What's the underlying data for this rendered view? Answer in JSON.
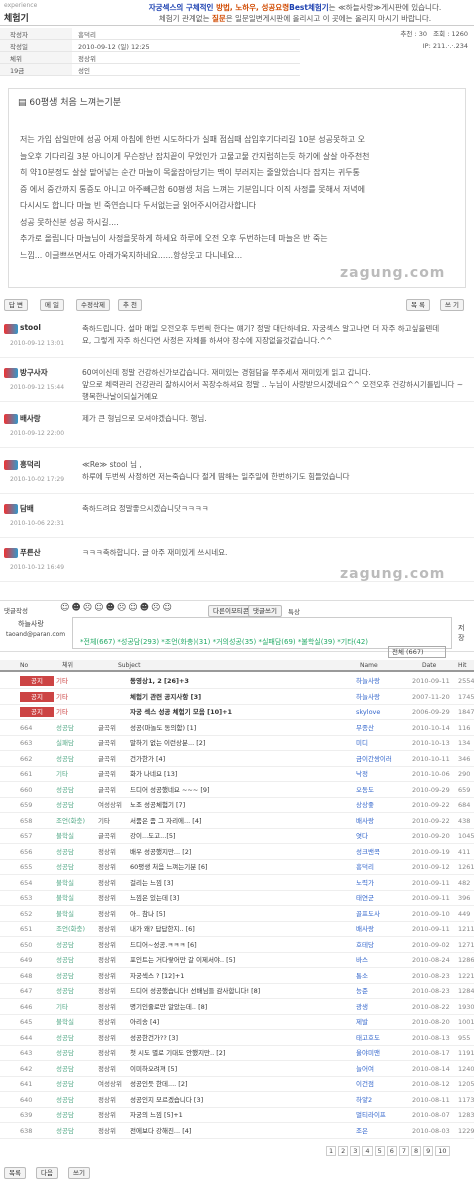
{
  "header": {
    "sub": "experience",
    "title": "체험기"
  },
  "notice": {
    "l1a": "자궁섹스의 구체적인 ",
    "l1b": "방법, 노하우, 성공요령",
    "l1c": "Best체험기",
    "l1d": "는 ≪하늘사랑≫게시판에 있습니다.",
    "l2a": "체험기 관계없는 ",
    "l2b": "질문",
    "l2c": "은 일문일변게시판에 올리시고 이 곳에는 올리지 마시기 바랍니다."
  },
  "meta": [
    {
      "k": "작성자",
      "v": "흥덕리"
    },
    {
      "k": "작성일",
      "v": "2010-09-12 (일) 12:25"
    },
    {
      "k": "체위",
      "v": "정상위"
    },
    {
      "k": "19금",
      "v": "성인"
    }
  ],
  "metaright": {
    "rec": "추천 : 30",
    "views": "조회 : 1260",
    "ip": "IP: 211.·.·.234"
  },
  "post": {
    "title": "60평생 처음 느껴는기분",
    "body": [
      "저는 가입 삼일만에 성공 어제 아침에 한번 시도하다가 실패 점심때 삽입후기다리길 10분 성공못하고 오",
      "늘오후 기다리길 3분 아니이게 무슨장난 잡치끝이 무었인가 고물고물 간지럽히는듯 하기에 살살 아주천천",
      "히 약10분정도 살살 맡어넣는 순간 마늘이 목울잡아당기는 맥이 부러지는 줄알았습니다 잡지는 귀두통",
      "증 에서 중간까지 통증도 아니고 아주빼근함 60평생 처음 느껴는 기분입니다 이직 사정를 못해서 저녁에",
      "다시시도 합니다 마늘 빈 죽연습니다 두서없는글 읽어주시어감사합니다",
      "성공 못하신분 성공 하시길....",
      "추가로 올립니다 마늘님이 사정을못하게 하세요 하루에 오전 오후 두번하는데 마늘은 반 죽는",
      "느낌... 이글쁘쓰면서도 아래가욱지하네요......항상웃고 다니네요..."
    ],
    "watermark": "zagung.com"
  },
  "buttons": {
    "reply": "답 변",
    "mail": "메 일",
    "edit": "수정삭제",
    "rec": "추 천",
    "list": "목 록",
    "write": "쓰 기"
  },
  "comments": [
    {
      "name": "stool",
      "date": "2010-09-12 13:01",
      "text": "축하드립니다. 설마 매일 오전오후 두번씩 한다는 얘기? 정말 대단하네요. 자궁섹스 알고나면 더 자주 하고싶을텐데",
      "text2": "요, 그렇게 자주 하신다면 사정은 자체를 하셔야 장수에 지장없을것같습니다.^^"
    },
    {
      "name": "방구사자",
      "date": "2010-09-12 15:44",
      "text": "60여이신데 정말 건강하신가보갑습니다. 재미있는 경험담을 쭈주세서 재미있게 읽고 갑니다.",
      "text2": "앞으로 체력관리 건강관리 잘하시어서 꼭장수하셔요 정말 ..  누님이 사랑받으시겠네요^^  오전오후 건강하시기를빕니다 ~ 행복한나날이되실거예요"
    },
    {
      "name": "배사랑",
      "date": "2010-09-12 22:00",
      "text": "제가 큰 형님으로 모셔야겠습니다. 행님.",
      "text2": ""
    },
    {
      "name": "흥덕리",
      "date": "2010-10-02 17:29",
      "text": "≪Re≫ stool 님 ,",
      "text2": "하루에 두번씩 사정하면 저는죽습니다 절게 땀해는 일주일에 한번하기도 힘들었습니다"
    },
    {
      "name": "담배",
      "date": "2010-10-06 22:31",
      "text": "축하드려요 정말좋으시겠습니닷ㅋㅋㅋㅋ",
      "text2": ""
    },
    {
      "name": "푸른산",
      "date": "2010-10-12 16:49",
      "text": "ㅋㅋㅋ축하합니다. 글 아주 재미있게 쓰시네요.",
      "text2": ""
    }
  ],
  "commentbox": {
    "label": "댓글작성",
    "user": "하늘사랑",
    "email": "taoand@paran.com",
    "sub1": "다른이모티콘",
    "sub2": "댓글쓰기",
    "sub3": "특상",
    "side": "저장"
  },
  "filters": "*전체(667) *성공담(293) *조언(화충)(31) *거의성공(35) *실패담(69) *불학실(39) *기타(42)",
  "select": "전체 (667)",
  "cols": {
    "no": "No",
    "pose": "체위",
    "subject": "Subject",
    "name": "Name",
    "date": "Date",
    "hit": "Hit"
  },
  "rows": [
    [
      "공지",
      "기타",
      "",
      "동영상1, 2 [26]+3",
      "하늘사랑",
      "2010-09-11",
      "2554"
    ],
    [
      "공지",
      "기타",
      "",
      "체험기 관련 공지사항 [3]",
      "하늘사랑",
      "2007-11-20",
      "1745"
    ],
    [
      "공지",
      "기타",
      "",
      "자궁 섹스 성공 체험기 모음 [10]+1",
      "skylove",
      "2006-09-29",
      "1847"
    ],
    [
      "664",
      "성공담",
      "글곡위",
      "성공(마놀도 동의함) [1]",
      "무종산",
      "2010-10-14",
      "116"
    ],
    [
      "663",
      "실패담",
      "글곡위",
      "말하기 없는 이런상분... [2]",
      "미디",
      "2010-10-13",
      "134"
    ],
    [
      "662",
      "성공담",
      "글곡위",
      "건가한가 [4]",
      "금이간쌍이러",
      "2010-10-11",
      "346"
    ],
    [
      "661",
      "기타",
      "글곡위",
      "화가 나네요 [13]",
      "낙정",
      "2010-10-06",
      "290"
    ],
    [
      "660",
      "성공담",
      "글곡위",
      "드디어 성공했네요 ~~~ [9]",
      "오동도",
      "2010-09-29",
      "659"
    ],
    [
      "659",
      "성공담",
      "여성상위",
      "노조 성공체험기 [7]",
      "상상좋",
      "2010-09-22",
      "684"
    ],
    [
      "658",
      "조언(화충)",
      "기타",
      "서품은 좀 그 자리에... [4]",
      "배사랑",
      "2010-09-22",
      "438"
    ],
    [
      "657",
      "불학실",
      "글곡위",
      "강이...도고...[5]",
      "엿다",
      "2010-09-20",
      "1045"
    ],
    [
      "656",
      "성공담",
      "정상위",
      "배우 성공했지만... [2]",
      "성크밴콕",
      "2010-09-19",
      "411"
    ],
    [
      "655",
      "성공담",
      "정상위",
      "60평생 처음 느껴는기분 [6]",
      "흥덕리",
      "2010-09-12",
      "1261"
    ],
    [
      "654",
      "불학실",
      "정상위",
      "걸리는 느낌 [3]",
      "노력가",
      "2010-09-11",
      "482"
    ],
    [
      "653",
      "불학실",
      "정상위",
      "느낌은 있는데 [3]",
      "태연군",
      "2010-09-11",
      "396"
    ],
    [
      "652",
      "불학실",
      "정상위",
      "아.. 참나 [5]",
      "골프도사",
      "2010-09-10",
      "449"
    ],
    [
      "651",
      "조언(화충)",
      "정상위",
      "내가 왜? 답답한지.. [6]",
      "배사랑",
      "2010-09-11",
      "1211"
    ],
    [
      "650",
      "성공담",
      "정상위",
      "드디어~성공.ㅋㅋㅋ [6]",
      "호테당",
      "2010-09-02",
      "1271"
    ],
    [
      "649",
      "성공담",
      "정상위",
      "포인트는 거다랗어만 갈 이제서야.. [5]",
      "바스",
      "2010-08-24",
      "1286"
    ],
    [
      "648",
      "성공담",
      "정상위",
      "자궁섹스 ? [12]+1",
      "통소",
      "2010-08-23",
      "1221"
    ],
    [
      "647",
      "성공담",
      "정상위",
      "드디어 성공했습니다! 선배님들 감사합니다! [8]",
      "능준",
      "2010-08-23",
      "1284"
    ],
    [
      "646",
      "기타",
      "정상위",
      "명기인줄로만 알았는데.. [8]",
      "광생",
      "2010-08-22",
      "1930"
    ],
    [
      "645",
      "불학실",
      "정상위",
      "아리송 [4]",
      "제발",
      "2010-08-20",
      "1001"
    ],
    [
      "644",
      "성공담",
      "정상위",
      "성공한건가?? [3]",
      "태고호도",
      "2010-08-13",
      "955"
    ],
    [
      "643",
      "성공담",
      "정상위",
      "첫 시도 별로 기대도 안했지만.. [2]",
      "울야미맨",
      "2010-08-17",
      "1191"
    ],
    [
      "642",
      "성공담",
      "정상위",
      "이미하오려져 [5]",
      "늘어여",
      "2010-08-14",
      "1240"
    ],
    [
      "641",
      "성공담",
      "여성상위",
      "성공인듯 한데.... [2]",
      "이건점",
      "2010-08-12",
      "1205"
    ],
    [
      "640",
      "성공담",
      "정상위",
      "성공인지 모르겠습니다 [3]",
      "하얗2",
      "2010-08-11",
      "1173"
    ],
    [
      "639",
      "성공담",
      "정상위",
      "자궁의 느낌 [5]+1",
      "멀티라이프",
      "2010-08-07",
      "1283"
    ],
    [
      "638",
      "성공담",
      "정상위",
      "전에보다 강해진... [4]",
      "조은",
      "2010-08-03",
      "1229"
    ]
  ],
  "pager": [
    "1",
    "2",
    "3",
    "4",
    "5",
    "6",
    "7",
    "8",
    "9",
    "10"
  ],
  "footer": {
    "list": "목록",
    "next": "다음",
    "write": "쓰기"
  }
}
